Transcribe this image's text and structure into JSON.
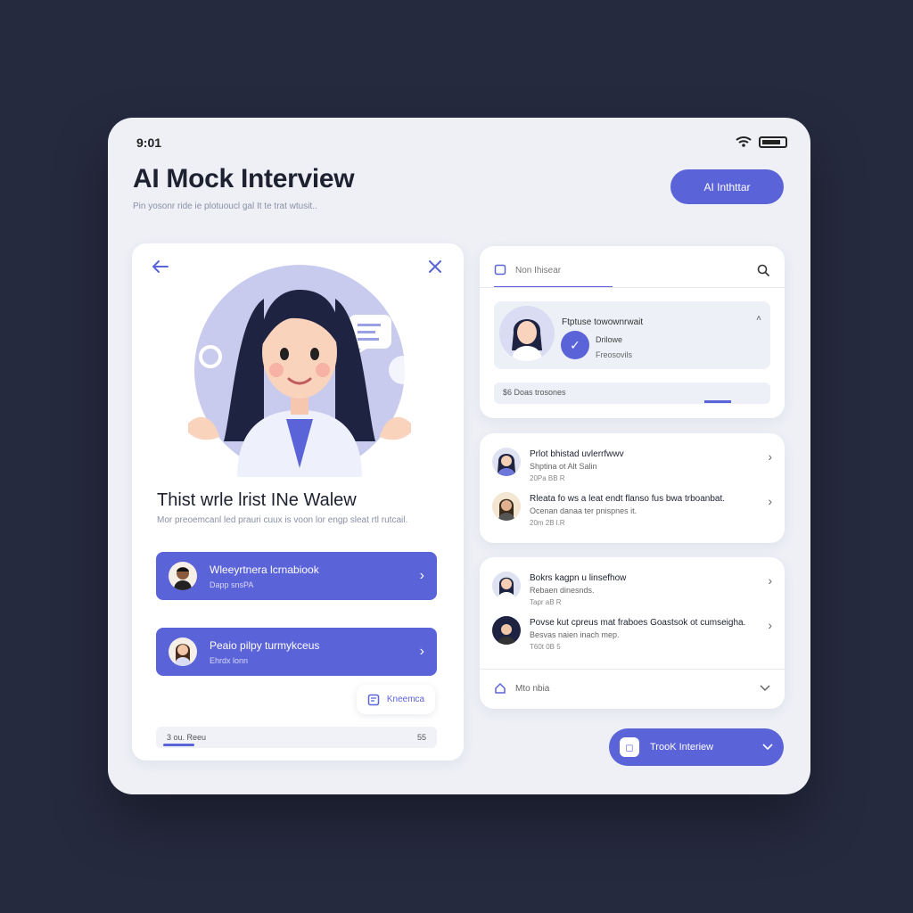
{
  "status": {
    "time": "9:01"
  },
  "header": {
    "title": "AI Mock Interview",
    "subtitle": "Pin yosonr ride ie plotuoucl gal It te trat wtusit..",
    "button_label": "AI Inthttar"
  },
  "hero": {
    "title": "Thist wrle lrist INe Walew",
    "subtitle": "Mor preoemcanl led prauri cuux is voon lor engp sleat rtl rutcail.",
    "actions": [
      {
        "title": "Wleeyrtnera lcrnabiook",
        "sub": "Dapp snsPA"
      },
      {
        "title": "Peaio pilpy turmykceus",
        "sub": "Ehrdx lonn"
      }
    ],
    "small_button": "Kneemca",
    "progress": {
      "left": "3 ou. Reeu",
      "right": "55",
      "value": 0.11
    }
  },
  "panel1": {
    "search_label": "Non Ihisear",
    "interviewer": {
      "title": "Ftptuse towownrwait",
      "line1": "Drilowe",
      "line2": "Freosovils"
    },
    "stat": "$6 Doas trosones"
  },
  "panel2": {
    "items": [
      {
        "t1": "Prlot bhistad uvlerrfwwv",
        "t2": "Shptina ot Alt Salin",
        "t3": "20Pa BB R"
      },
      {
        "t1": "Rleata fo ws a leat endt flanso fus bwa trboanbat.",
        "t2": "Ocenan danaa ter pnispnes it.",
        "t3": "20m 2B l.R"
      }
    ]
  },
  "panel3": {
    "items": [
      {
        "t1": "Bokrs kagpn u linsefhow",
        "t2": "Rebaen dinesnds.",
        "t3": "Tapr aB R"
      },
      {
        "t1": "Povse kut cpreus mat fraboes Goastsok ot cumseigha.",
        "t2": "Besvas naien inach mep.",
        "t3": "T60t 0B 5"
      }
    ],
    "dropdown_label": "Mto nbia"
  },
  "bottom_button": "TrooK Interiew"
}
